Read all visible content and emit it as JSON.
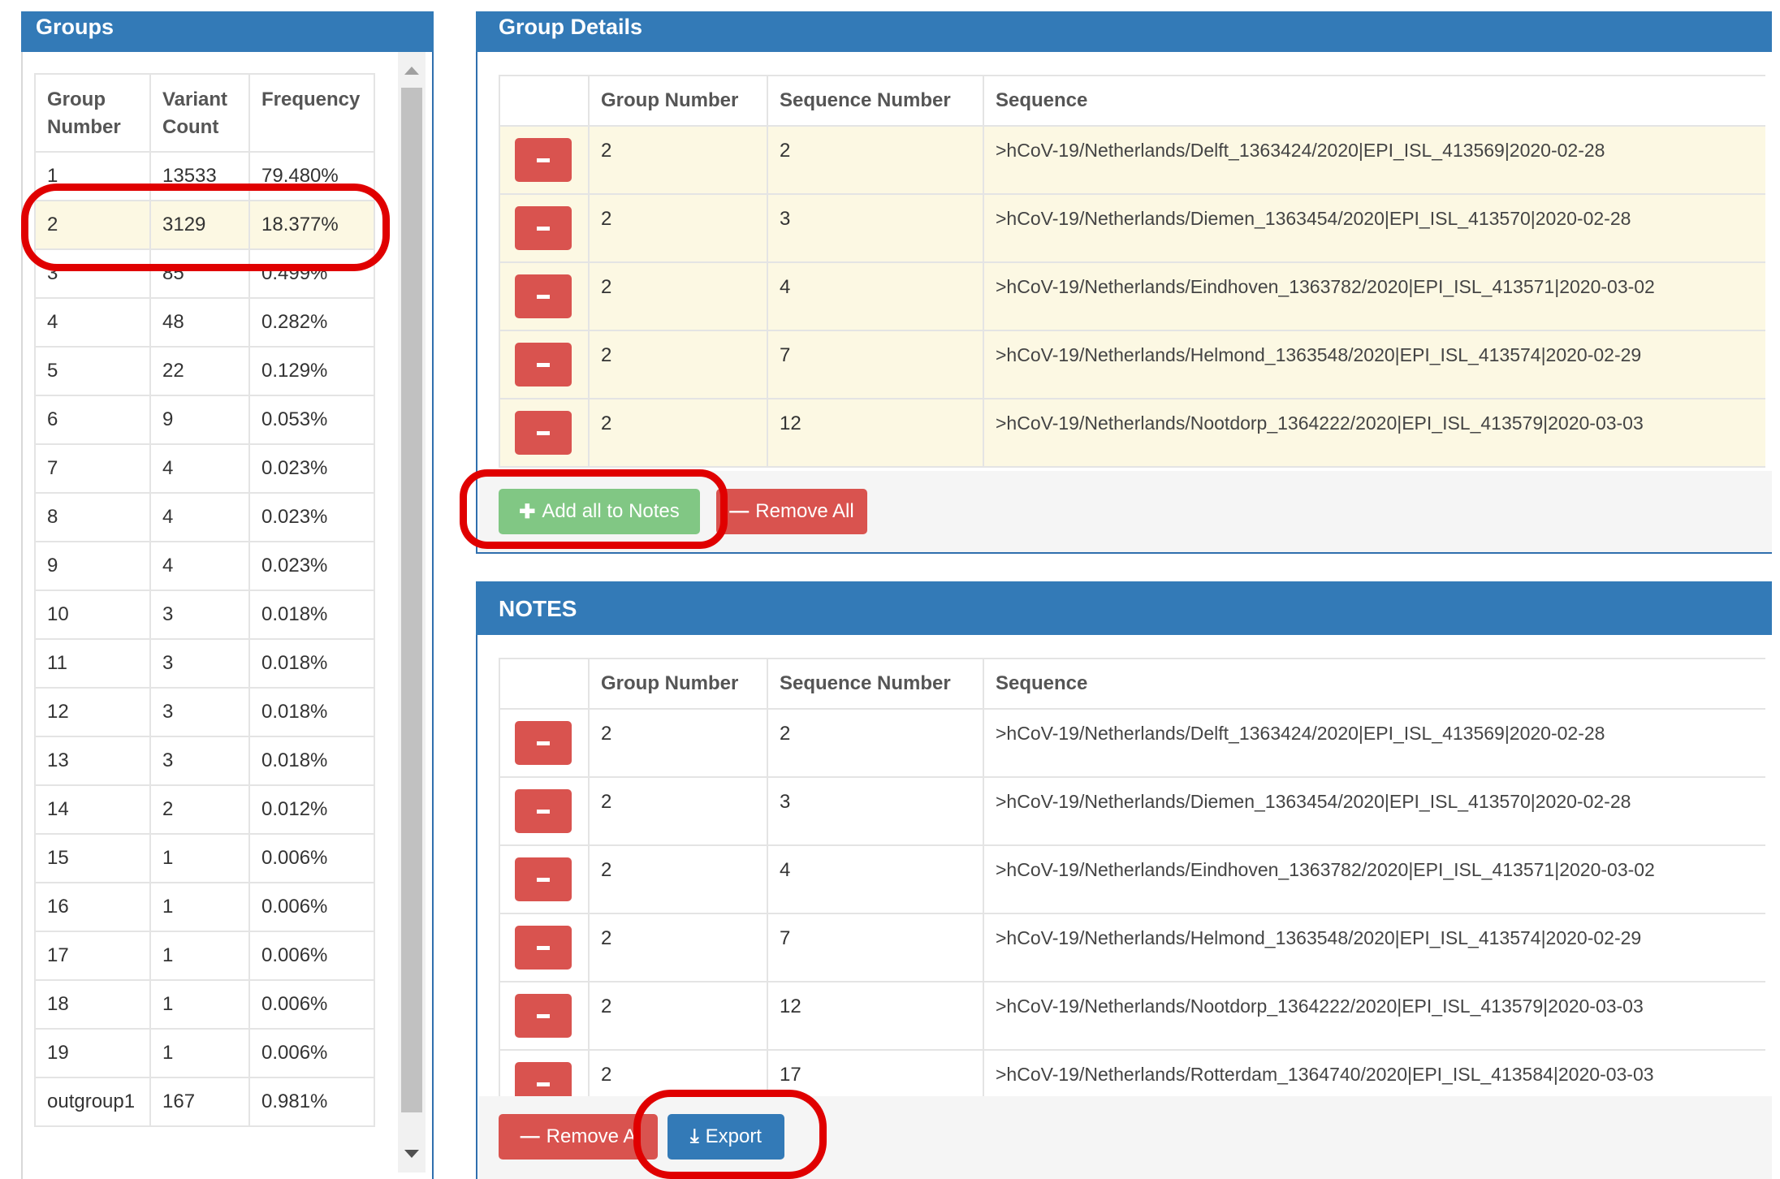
{
  "groups_panel": {
    "title": "Groups",
    "columns": [
      "Group Number",
      "Variant Count",
      "Frequency"
    ],
    "rows": [
      [
        "1",
        "13533",
        "79.480%"
      ],
      [
        "2",
        "3129",
        "18.377%"
      ],
      [
        "3",
        "85",
        "0.499%"
      ],
      [
        "4",
        "48",
        "0.282%"
      ],
      [
        "5",
        "22",
        "0.129%"
      ],
      [
        "6",
        "9",
        "0.053%"
      ],
      [
        "7",
        "4",
        "0.023%"
      ],
      [
        "8",
        "4",
        "0.023%"
      ],
      [
        "9",
        "4",
        "0.023%"
      ],
      [
        "10",
        "3",
        "0.018%"
      ],
      [
        "11",
        "3",
        "0.018%"
      ],
      [
        "12",
        "3",
        "0.018%"
      ],
      [
        "13",
        "3",
        "0.018%"
      ],
      [
        "14",
        "2",
        "0.012%"
      ],
      [
        "15",
        "1",
        "0.006%"
      ],
      [
        "16",
        "1",
        "0.006%"
      ],
      [
        "17",
        "1",
        "0.006%"
      ],
      [
        "18",
        "1",
        "0.006%"
      ],
      [
        "19",
        "1",
        "0.006%"
      ],
      [
        "outgroup1",
        "167",
        "0.981%"
      ]
    ],
    "selected_group": "2"
  },
  "details_panel": {
    "title": "Group Details",
    "columns": [
      "",
      "Group Number",
      "Sequence Number",
      "Sequence"
    ],
    "rows": [
      [
        "2",
        "2",
        ">hCoV-19/Netherlands/Delft_1363424/2020|EPI_ISL_413569|2020-02-28"
      ],
      [
        "2",
        "3",
        ">hCoV-19/Netherlands/Diemen_1363454/2020|EPI_ISL_413570|2020-02-28"
      ],
      [
        "2",
        "4",
        ">hCoV-19/Netherlands/Eindhoven_1363782/2020|EPI_ISL_413571|2020-03-02"
      ],
      [
        "2",
        "7",
        ">hCoV-19/Netherlands/Helmond_1363548/2020|EPI_ISL_413574|2020-02-29"
      ],
      [
        "2",
        "12",
        ">hCoV-19/Netherlands/Nootdorp_1364222/2020|EPI_ISL_413579|2020-03-03"
      ]
    ],
    "add_all_label": "Add all to Notes",
    "remove_all_label": "Remove All"
  },
  "notes_panel": {
    "title": "NOTES",
    "columns": [
      "",
      "Group Number",
      "Sequence Number",
      "Sequence"
    ],
    "rows": [
      [
        "2",
        "2",
        ">hCoV-19/Netherlands/Delft_1363424/2020|EPI_ISL_413569|2020-02-28"
      ],
      [
        "2",
        "3",
        ">hCoV-19/Netherlands/Diemen_1363454/2020|EPI_ISL_413570|2020-02-28"
      ],
      [
        "2",
        "4",
        ">hCoV-19/Netherlands/Eindhoven_1363782/2020|EPI_ISL_413571|2020-03-02"
      ],
      [
        "2",
        "7",
        ">hCoV-19/Netherlands/Helmond_1363548/2020|EPI_ISL_413574|2020-02-29"
      ],
      [
        "2",
        "12",
        ">hCoV-19/Netherlands/Nootdorp_1364222/2020|EPI_ISL_413579|2020-03-03"
      ],
      [
        "2",
        "17",
        ">hCoV-19/Netherlands/Rotterdam_1364740/2020|EPI_ISL_413584|2020-03-03"
      ]
    ],
    "remove_all_label": "Remove A",
    "export_label": "Export"
  },
  "icons": {
    "remove_row": "minus-icon",
    "add": "plus-icon",
    "export": "download-icon",
    "scroll_up": "scroll-up-arrow-icon",
    "scroll_down": "scroll-down-arrow-icon"
  },
  "colors": {
    "panel_header": "#337ab7",
    "highlight_row": "#fcf8e3",
    "danger": "#d9534f",
    "success": "#81c784",
    "primary": "#337ab7",
    "annotation_ring": "#e00000"
  }
}
